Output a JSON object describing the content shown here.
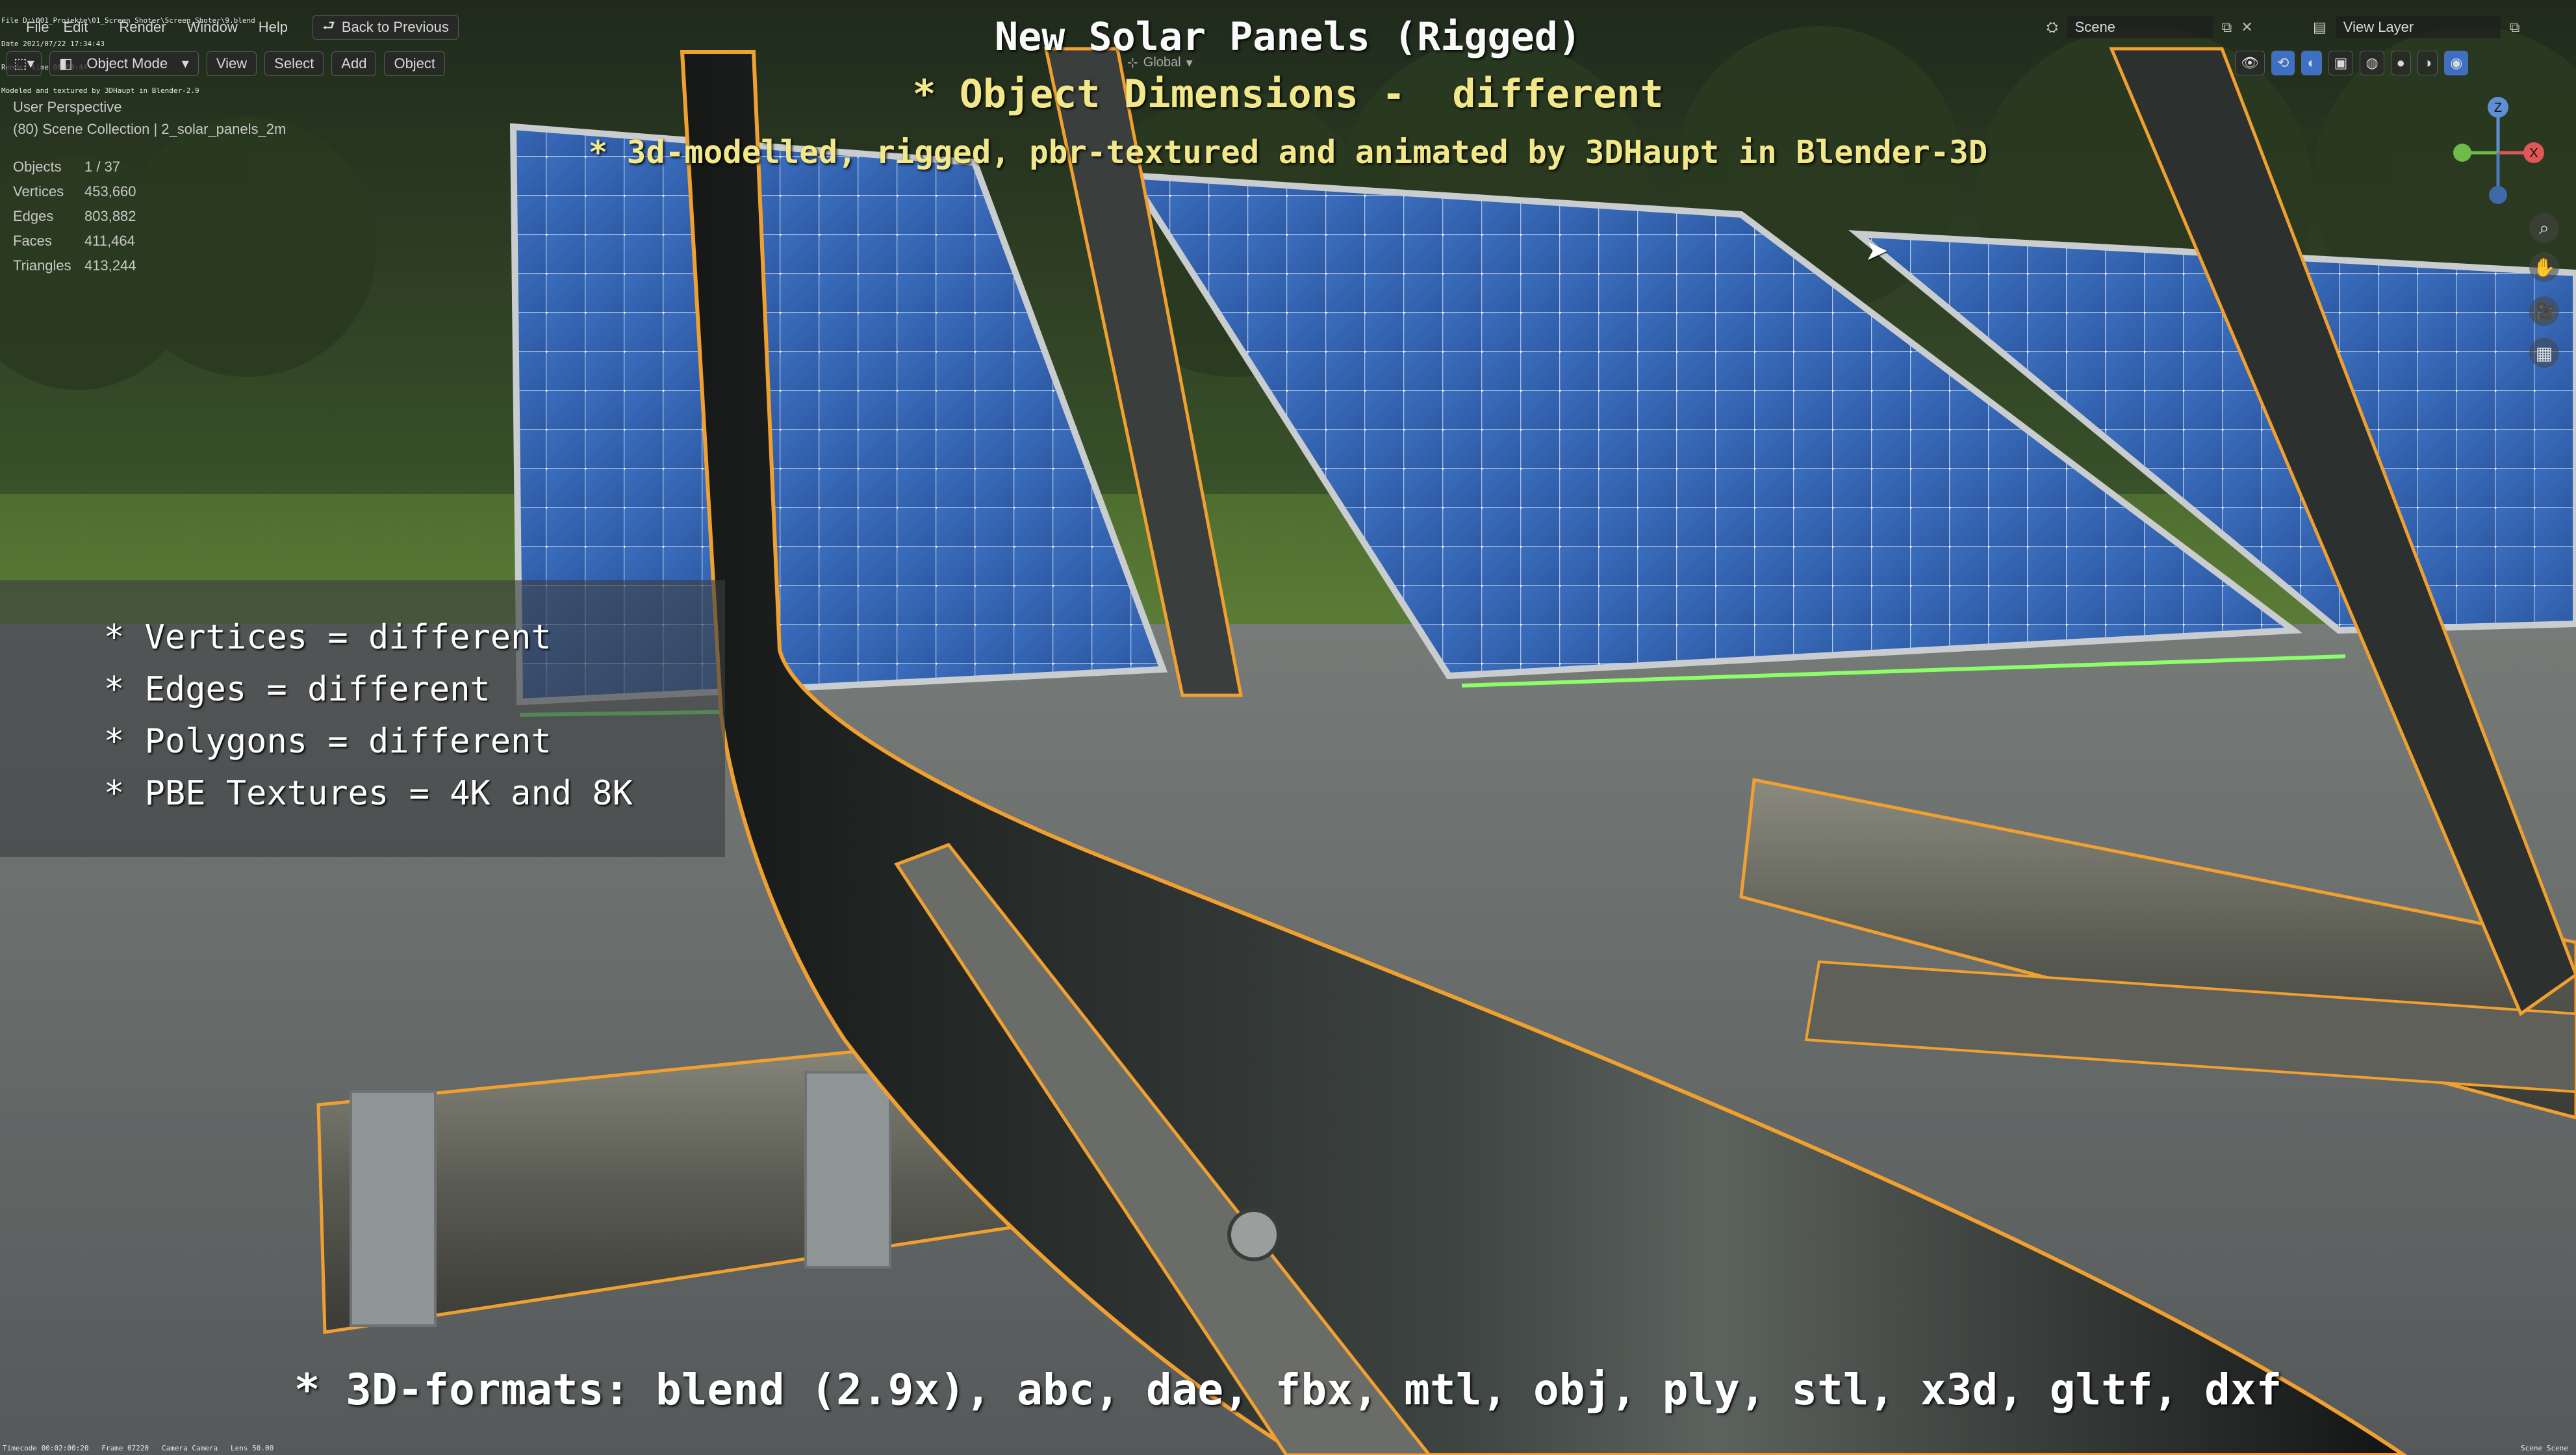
{
  "burn_in": {
    "top_lines": [
      "File D:\\001_Projekte\\01_Screen_Shoter\\Screen_Shoter\\9.blend",
      "Date 2021/07/22 17:34:43",
      "Render time 00:00:44",
      "Modeled and textured by 3DHaupt in Blender-2.9"
    ],
    "bottom_left": "Timecode 00:02:00:20   Frame 07220   Camera Camera   Lens 50.00",
    "bottom_right": "Scene Scene"
  },
  "menubar": {
    "items": [
      "File",
      "Edit",
      "Render",
      "Window",
      "Help"
    ],
    "back_button": "Back to Previous",
    "scene_label": "Scene",
    "view_layer_label": "View Layer"
  },
  "viewport_header": {
    "mode": "Object Mode",
    "menus": [
      "View",
      "Select",
      "Add",
      "Object"
    ],
    "transform_orientation": "Global"
  },
  "viewport_info": {
    "perspective": "User Perspective",
    "collection": "(80) Scene Collection | 2_solar_panels_2m",
    "stats": [
      {
        "label": "Objects",
        "value": "1 / 37"
      },
      {
        "label": "Vertices",
        "value": "453,660"
      },
      {
        "label": "Edges",
        "value": "803,882"
      },
      {
        "label": "Faces",
        "value": "411,464"
      },
      {
        "label": "Triangles",
        "value": "413,244"
      }
    ]
  },
  "overlay": {
    "title": "New Solar Panels (Rigged)",
    "subtitle": "* Object Dimensions -  different",
    "credit": "* 3d-modelled, rigged, pbr-textured and animated by 3DHaupt in Blender-3D",
    "features": [
      "* Vertices = different",
      "* Edges = different",
      "* Polygons = different",
      "* PBE Textures = 4K and 8K"
    ],
    "formats": "* 3D-formats: blend (2.9x), abc, dae, fbx, mtl, obj, ply, stl, x3d, gltf, dxf"
  },
  "gizmo": {
    "axes": [
      "Z",
      "X",
      "Y"
    ]
  },
  "colors": {
    "subtitle": "#f2e88a",
    "selection_outline": "#f0a030",
    "active_outline": "#7cff7c",
    "panel_blue": "#3f77c4"
  },
  "icons": [
    "editor-type-icon",
    "mode-icon",
    "zoom-icon",
    "pan-hand-icon",
    "camera-view-icon",
    "grid-view-icon",
    "mouse-cursor-icon"
  ]
}
